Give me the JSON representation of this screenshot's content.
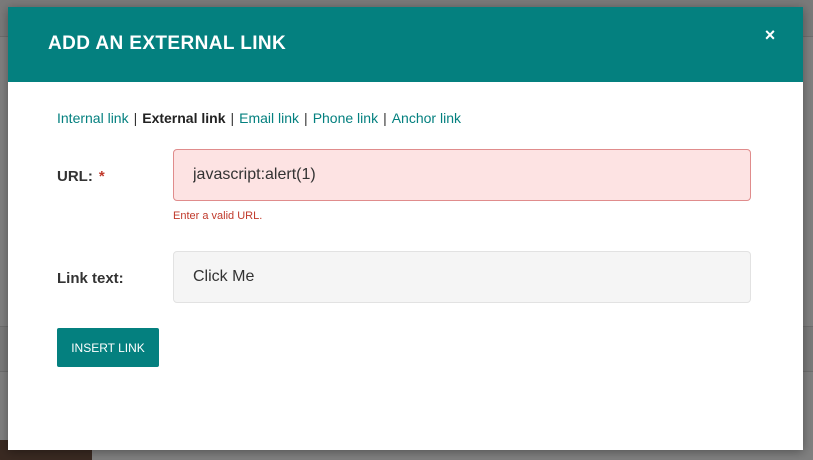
{
  "modal": {
    "title": "ADD AN EXTERNAL LINK",
    "close_icon": "×",
    "tabs": [
      {
        "label": "Internal link"
      },
      {
        "label": "External link"
      },
      {
        "label": "Email link"
      },
      {
        "label": "Phone link"
      },
      {
        "label": "Anchor link"
      }
    ],
    "tab_separator": "|",
    "url": {
      "label": "URL:",
      "required_marker": "*",
      "value": "javascript:alert(1)",
      "error": "Enter a valid URL."
    },
    "link_text": {
      "label": "Link text:",
      "value": "Click Me"
    },
    "insert_button": "INSERT LINK"
  },
  "colors": {
    "accent": "#04807f",
    "error": "#c0392b",
    "error_bg": "#fde3e3"
  }
}
